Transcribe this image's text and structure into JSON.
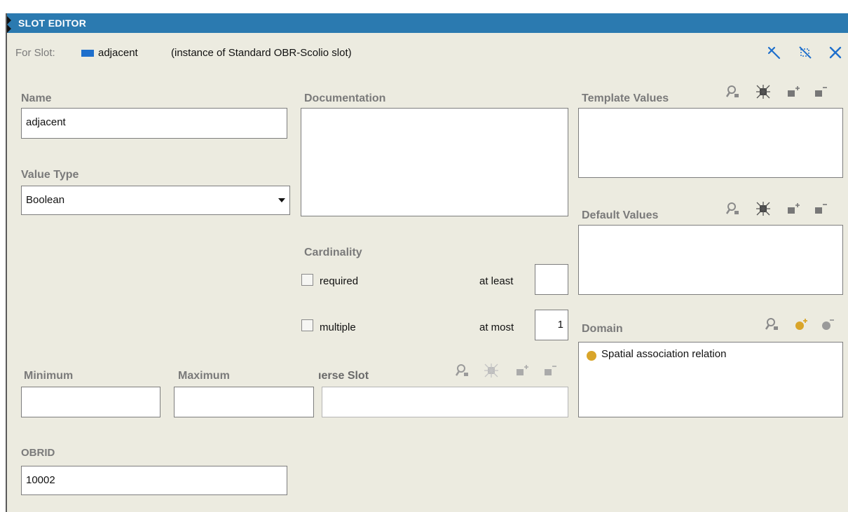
{
  "header": {
    "title": "SLOT EDITOR",
    "for_slot_label": "For Slot:",
    "slot_name": "adjacent",
    "instance_info": "(instance of Standard OBR-Scolio slot)"
  },
  "fields": {
    "name_label": "Name",
    "name_value": "adjacent",
    "value_type_label": "Value Type",
    "value_type_value": "Boolean",
    "documentation_label": "Documentation",
    "documentation_value": "",
    "cardinality_label": "Cardinality",
    "required_label": "required",
    "multiple_label": "multiple",
    "at_least_label": "at least",
    "at_least_value": "",
    "at_most_label": "at most",
    "at_most_value": "1",
    "minimum_label": "Minimum",
    "minimum_value": "",
    "maximum_label": "Maximum",
    "maximum_value": "",
    "inverse_slot_label": "ıerse Slot",
    "inverse_slot_value": "",
    "obrid_label": "OBRID",
    "obrid_value": "10002"
  },
  "template_values": {
    "label": "Template Values"
  },
  "default_values": {
    "label": "Default Values"
  },
  "domain": {
    "label": "Domain",
    "items": [
      "Spatial association relation"
    ]
  },
  "colors": {
    "titlebar": "#2b7ab0",
    "panel_bg": "#ecebe0",
    "label_gray": "#7a7a7a",
    "icon_blue": "#1e6fcc",
    "domain_dot": "#d9a52a"
  },
  "icons": {
    "header": [
      "collapse-icon",
      "hide-icon",
      "close-icon"
    ],
    "list_tools": [
      "view-icon",
      "delete-icon",
      "create-icon",
      "remove-icon"
    ],
    "domain_tools": [
      "view-icon",
      "add-class-icon",
      "remove-class-icon"
    ]
  }
}
